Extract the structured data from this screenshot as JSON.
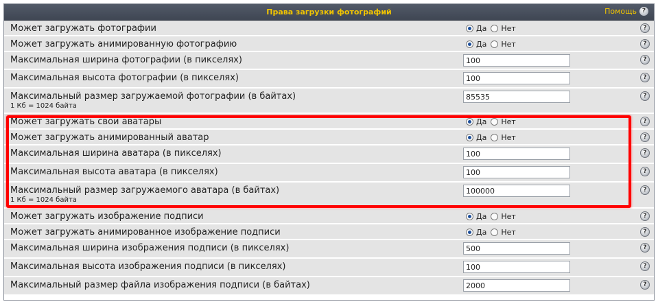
{
  "header": {
    "title": "Права загрузки фотографий",
    "help_label": "Помощь",
    "help_icon": "?"
  },
  "options": {
    "yes": "Да",
    "no": "Нет"
  },
  "rows": [
    {
      "label": "Может загружать фотографии",
      "type": "radio",
      "value": "yes"
    },
    {
      "label": "Может загружать анимированную фотографию",
      "type": "radio",
      "value": "yes"
    },
    {
      "label": "Максимальная ширина фотографии (в пикселях)",
      "type": "text",
      "value": "100"
    },
    {
      "label": "Максимальная высота фотографии (в пикселях)",
      "type": "text",
      "value": "100"
    },
    {
      "label": "Максимальный размер загружаемой фотографии (в байтах)",
      "sublabel": "1 Кб = 1024 байта",
      "type": "text",
      "value": "85535"
    },
    {
      "label": "Может загружать свои аватары",
      "type": "radio",
      "value": "yes"
    },
    {
      "label": "Может загружать анимированный аватар",
      "type": "radio",
      "value": "yes"
    },
    {
      "label": "Максимальная ширина аватара (в пикселях)",
      "type": "text",
      "value": "100"
    },
    {
      "label": "Максимальная высота аватара (в пикселях)",
      "type": "text",
      "value": "100"
    },
    {
      "label": "Максимальный размер загружаемого аватара (в байтах)",
      "sublabel": "1 Кб = 1024 байта",
      "type": "text",
      "value": "100000"
    },
    {
      "label": "Может загружать изображение подписи",
      "type": "radio",
      "value": "yes"
    },
    {
      "label": "Может загружать анимированное изображение подписи",
      "type": "radio",
      "value": "yes"
    },
    {
      "label": "Максимальная ширина изображения подписи (в пикселях)",
      "type": "text",
      "value": "500"
    },
    {
      "label": "Максимальная высота изображения подписи (в пикселях)",
      "type": "text",
      "value": "100"
    },
    {
      "label": "Максимальный размер файла изображения подписи (в байтах)",
      "type": "text",
      "value": "2000"
    }
  ],
  "colors": {
    "header_bg": "#474e5b",
    "header_text": "#f2c500",
    "row_bg": "#e4e4e4",
    "highlight": "#ff0000"
  }
}
